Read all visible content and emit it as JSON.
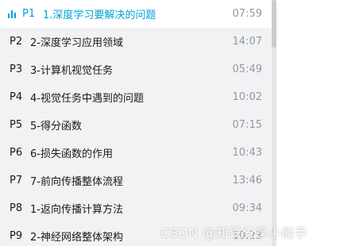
{
  "episodes": [
    {
      "num": "P1",
      "title": "1.深度学习要解决的问题",
      "duration": "07:59",
      "active": true
    },
    {
      "num": "P2",
      "title": "2-深度学习应用领域",
      "duration": "14:07"
    },
    {
      "num": "P3",
      "title": "3-计算机视觉任务",
      "duration": "05:49"
    },
    {
      "num": "P4",
      "title": "4-视觉任务中遇到的问题",
      "duration": "10:02"
    },
    {
      "num": "P5",
      "title": "5-得分函数",
      "duration": "07:15"
    },
    {
      "num": "P6",
      "title": "6-损失函数的作用",
      "duration": "10:43"
    },
    {
      "num": "P7",
      "title": "7-前向传播整体流程",
      "duration": "13:46"
    },
    {
      "num": "P8",
      "title": "1-返向传播计算方法",
      "duration": "09:34"
    },
    {
      "num": "P9",
      "title": "2-神经网络整体架构",
      "duration": "10:23"
    }
  ],
  "watermark": "CSDN @知识分享小能手",
  "colors": {
    "accent": "#00a1d6",
    "panel_bg": "#f1f2f3",
    "active_bg": "#ffffff",
    "duration_text": "#9499a0"
  },
  "icons": {
    "playing": "audio-bars-icon"
  }
}
